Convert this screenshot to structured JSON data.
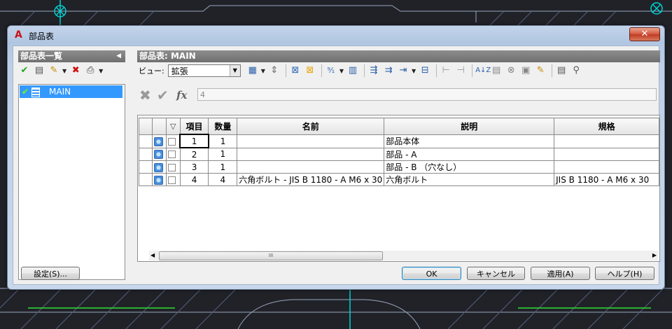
{
  "window": {
    "title": "部品表",
    "close_symbol": "✕"
  },
  "left_panel": {
    "header": "部品表一覧",
    "items": [
      {
        "label": "MAIN",
        "selected": true
      }
    ]
  },
  "right_panel": {
    "header": "部品表: MAIN",
    "view_label": "ビュー:",
    "view_value": "拡張",
    "formula_value": "4",
    "fx_label": "fx"
  },
  "table": {
    "columns": [
      "項目",
      "数量",
      "名前",
      "説明",
      "規格"
    ],
    "rows": [
      {
        "item": "1",
        "qty": "1",
        "name": "",
        "desc": "部品本体",
        "spec": ""
      },
      {
        "item": "2",
        "qty": "1",
        "name": "",
        "desc": "部品 - A",
        "spec": ""
      },
      {
        "item": "3",
        "qty": "1",
        "name": "",
        "desc": "部品 - B （穴なし）",
        "spec": ""
      },
      {
        "item": "4",
        "qty": "4",
        "name": "六角ボルト - JIS B 1180 - A M6 x 30",
        "desc": "六角ボルト",
        "spec": "JIS B 1180 - A M6 x 30"
      }
    ],
    "scroll_thumb": "III"
  },
  "buttons": {
    "settings": "設定(S)...",
    "ok": "OK",
    "cancel": "キャンセル",
    "apply": "適用(A)",
    "help": "ヘルプ(H)"
  },
  "colors": {
    "accent_selection": "#3399ff",
    "cad_background": "#202228",
    "cad_lines": "#8fa6c8"
  }
}
